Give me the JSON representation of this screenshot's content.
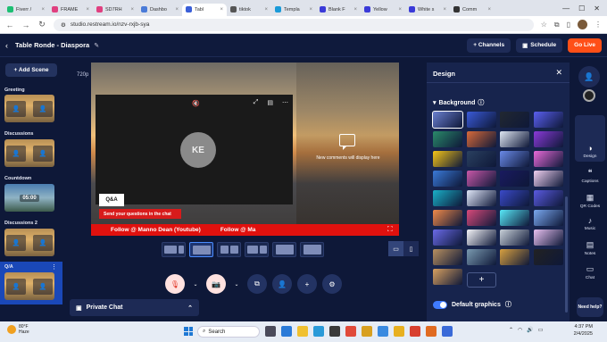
{
  "browser": {
    "tabs": [
      {
        "label": "Fiverr /",
        "color": "#1dbf73",
        "active": false
      },
      {
        "label": "FRAME",
        "color": "#e04080",
        "active": false
      },
      {
        "label": "SD7RH",
        "color": "#e04080",
        "active": false
      },
      {
        "label": "Dashbo",
        "color": "#4a7bd8",
        "active": false
      },
      {
        "label": "Tabl",
        "color": "#3a5fd8",
        "active": true
      },
      {
        "label": "tiktok",
        "color": "#555555",
        "active": false
      },
      {
        "label": "Templa",
        "color": "#1a9ad8",
        "active": false
      },
      {
        "label": "Blank F",
        "color": "#3a3ad8",
        "active": false
      },
      {
        "label": "Yellow",
        "color": "#3a3ad8",
        "active": false
      },
      {
        "label": "White s",
        "color": "#3a3ad8",
        "active": false
      },
      {
        "label": "Comm",
        "color": "#333333",
        "active": false
      }
    ],
    "url": "studio.restream.io/nzv-rxjb-sya"
  },
  "header": {
    "title": "Table Ronde - Diaspora",
    "channels_label": "+ Channels",
    "schedule_label": "Schedule",
    "golive_label": "Go Live"
  },
  "scenes": {
    "add_label": "+ Add Scene",
    "items": [
      {
        "label": "Greeting"
      },
      {
        "label": "Discussions"
      },
      {
        "label": "Countdown",
        "clock": "05:00"
      },
      {
        "label": "Discussions 2"
      },
      {
        "label": "Q/A"
      }
    ]
  },
  "stage": {
    "resolution": "720p",
    "avatar_initials": "KE",
    "qa_label": "Q&A",
    "qa_banner": "Send your questions in the chat",
    "ticker_text_1": "Follow @ Manno Dean (Youtube)",
    "ticker_text_2": "Follow @ Ma",
    "comments_placeholder": "New comments will display here"
  },
  "private_chat": {
    "label": "Private Chat"
  },
  "design": {
    "title": "Design",
    "background_label": "Background",
    "default_graphics_label": "Default graphics",
    "swatches": [
      "#6a7fd0",
      "#3a5ad8",
      "#222831",
      "#5a5ff0",
      "#2a8a6a",
      "#d86a3a",
      "#dfe6f2",
      "#8a3ad8",
      "#f5c518",
      "#2a4060",
      "#6a8ae8",
      "#e86ad8",
      "#3a7ad8",
      "#c858a8",
      "#1a1a60",
      "#f0d0f0",
      "#1ab0c8",
      "#e0e6f8",
      "#3a4ac8",
      "#5a5ae0",
      "#f08a4a",
      "#d84a7a",
      "#58e8f8",
      "#7aa8f0",
      "#6a6ae8",
      "#f5f5f8",
      "#c8d0d8",
      "#e8c0f0",
      "#b89060",
      "#7a9ab0",
      "#d8a040",
      "#222222",
      "#d8a060"
    ]
  },
  "rail": {
    "items": [
      {
        "label": "Design",
        "icon": "palette-icon",
        "glyph": "◑"
      },
      {
        "label": "Captions",
        "icon": "captions-icon",
        "glyph": "❝"
      },
      {
        "label": "QR Codes",
        "icon": "qr-icon",
        "glyph": "▦"
      },
      {
        "label": "Music",
        "icon": "music-icon",
        "glyph": "♪"
      },
      {
        "label": "Notes",
        "icon": "notes-icon",
        "glyph": "▤"
      },
      {
        "label": "Chat",
        "icon": "chat-icon",
        "glyph": "▭"
      }
    ],
    "need_help": "Need help?"
  },
  "taskbar": {
    "temp": "80°F",
    "weather": "Haze",
    "search_placeholder": "Search",
    "time": "4:37 PM",
    "date": "2/4/2025"
  }
}
